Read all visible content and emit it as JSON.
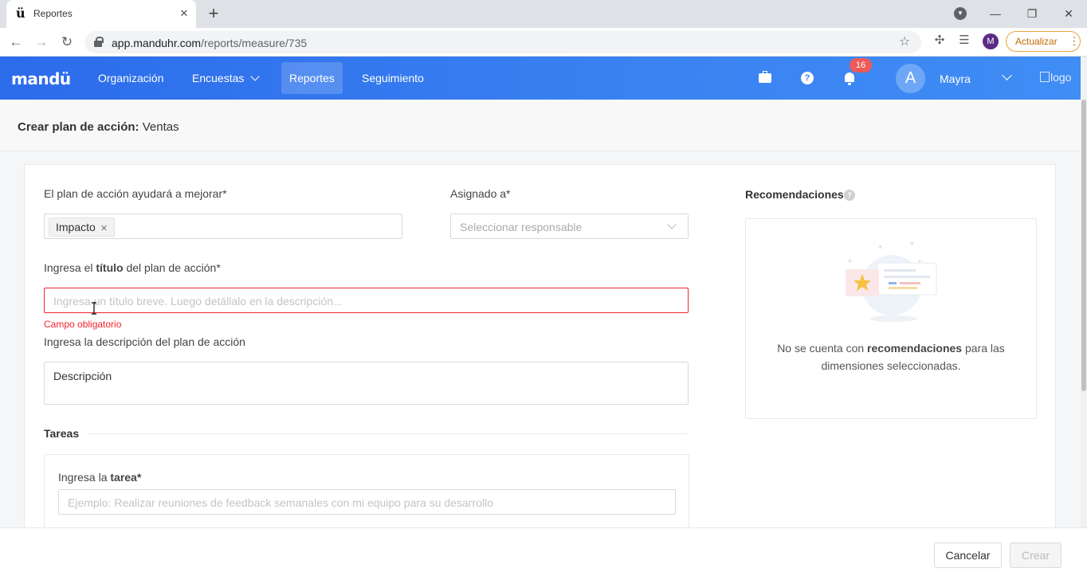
{
  "browser": {
    "tab_title": "Reportes",
    "tab_favicon": "ü",
    "url_host": "app.manduhr.com",
    "url_path": "/reports/measure/735",
    "profile_initial": "M",
    "update_label": "Actualizar"
  },
  "app": {
    "brand": "mandü",
    "nav": [
      {
        "label": "Organización"
      },
      {
        "label": "Encuestas"
      },
      {
        "label": "Reportes"
      },
      {
        "label": "Seguimiento"
      }
    ],
    "notifications_count": "16",
    "user_initial": "A",
    "user_name": "Mayra",
    "logo_alt": "logo"
  },
  "page": {
    "title_prefix": "Crear plan de acción:",
    "title_value": "Ventas"
  },
  "form": {
    "improve_label": "El plan de acción ayudará a mejorar*",
    "improve_tag": "Impacto",
    "assigned_label": "Asignado a*",
    "assigned_placeholder": "Seleccionar responsable",
    "title_label_pre": "Ingresa el ",
    "title_label_bold": "título",
    "title_label_post": " del plan de acción*",
    "title_placeholder": "Ingresa un título breve. Luego detállalo en la descripción...",
    "title_error": "Campo obligatorio",
    "desc_label": "Ingresa la descripción del plan de acción",
    "desc_value": "Descripción",
    "tasks_title": "Tareas",
    "task_label_pre": "Ingresa la ",
    "task_label_bold": "tarea*",
    "task_placeholder": "Ejemplo: Realizar reuniones de feedback semanales con mi equipo para su desarrollo"
  },
  "recommendations": {
    "title": "Recomendaciones",
    "empty_pre": "No se cuenta con ",
    "empty_bold": "recomendaciones",
    "empty_post": " para las",
    "empty_line2": "dimensiones seleccionadas."
  },
  "footer": {
    "cancel_label": "Cancelar",
    "create_label": "Crear"
  },
  "colors": {
    "header_blue": "#3a82f2",
    "error_red": "#f5222d",
    "badge_red": "#ee5a57"
  }
}
